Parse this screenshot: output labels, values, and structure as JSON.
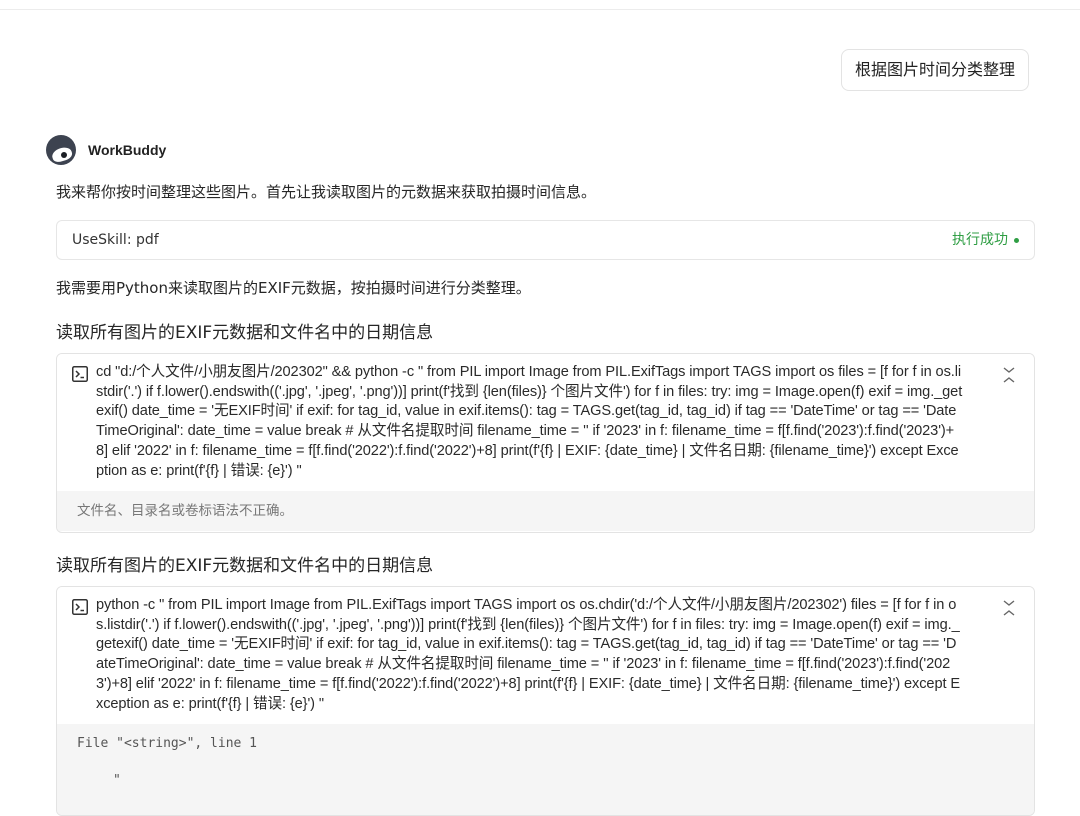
{
  "user_message": "根据图片时间分类整理",
  "assistant": {
    "name": "WorkBuddy",
    "avatar_icon": "raccoon-avatar-icon"
  },
  "intro_text": "我来帮你按时间整理这些图片。首先让我读取图片的元数据来获取拍摄时间信息。",
  "skill": {
    "label": "UseSkill: pdf",
    "status": "执行成功",
    "status_color": "#2f9e44"
  },
  "plan_text": "我需要用Python来读取图片的EXIF元数据，按拍摄时间进行分类整理。",
  "steps": [
    {
      "title": "读取所有图片的EXIF元数据和文件名中的日期信息",
      "command": "cd \"d:/个人文件/小朋友图片/202302\" && python -c \" from PIL import Image from PIL.ExifTags import TAGS import os files = [f for f in os.listdir('.') if f.lower().endswith(('.jpg', '.jpeg', '.png'))] print(f'找到 {len(files)} 个图片文件') for f in files: try: img = Image.open(f) exif = img._getexif() date_time = '无EXIF时间' if exif: for tag_id, value in exif.items(): tag = TAGS.get(tag_id, tag_id) if tag == 'DateTime' or tag == 'DateTimeOriginal': date_time = value break # 从文件名提取时间 filename_time = '' if '2023' in f: filename_time = f[f.find('2023'):f.find('2023')+8] elif '2022' in f: filename_time = f[f.find('2022'):f.find('2022')+8] print(f'{f} | EXIF: {date_time} | 文件名日期: {filename_time}') except Exception as e: print(f'{f} | 错误: {e}') \"",
      "output": "文件名、目录名或卷标语法不正确。"
    },
    {
      "title": "读取所有图片的EXIF元数据和文件名中的日期信息",
      "command": "python -c \" from PIL import Image from PIL.ExifTags import TAGS import os os.chdir('d:/个人文件/小朋友图片/202302') files = [f for f in os.listdir('.') if f.lower().endswith(('.jpg', '.jpeg', '.png'))] print(f'找到 {len(files)} 个图片文件') for f in files: try: img = Image.open(f) exif = img._getexif() date_time = '无EXIF时间' if exif: for tag_id, value in exif.items(): tag = TAGS.get(tag_id, tag_id) if tag == 'DateTime' or tag == 'DateTimeOriginal': date_time = value break # 从文件名提取时间 filename_time = '' if '2023' in f: filename_time = f[f.find('2023'):f.find('2023')+8] elif '2022' in f: filename_time = f[f.find('2022'):f.find('2022')+8] print(f'{f} | EXIF: {date_time} | 文件名日期: {filename_time}') except Exception as e: print(f'{f} | 错误: {e}') \"",
      "output_line1": "File \"<string>\", line 1",
      "output_line2": "\""
    }
  ],
  "icons": {
    "terminal": "terminal-icon",
    "collapse": "collapse-icon"
  }
}
